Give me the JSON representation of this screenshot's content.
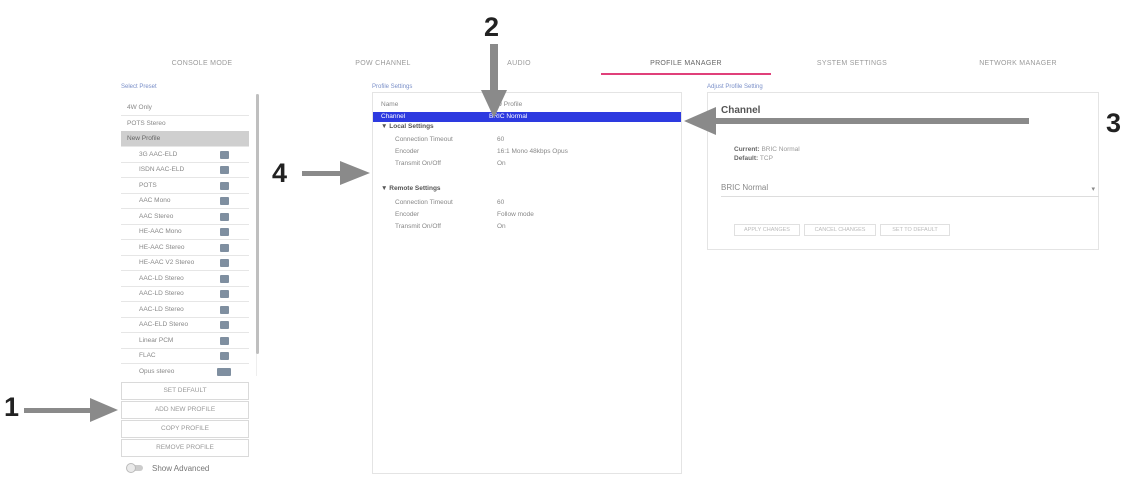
{
  "tabs": [
    {
      "label": "CONSOLE MODE"
    },
    {
      "label": "POW CHANNEL"
    },
    {
      "label": "AUDIO"
    },
    {
      "label": "PROFILE MANAGER"
    },
    {
      "label": "SYSTEM SETTINGS"
    },
    {
      "label": "NETWORK MANAGER"
    }
  ],
  "sections": {
    "presets": "Select Preset",
    "profile": "Profile Settings",
    "channel": "Adjust Profile Setting"
  },
  "presets": [
    {
      "label": "4W Only",
      "icon": ""
    },
    {
      "label": "POTS Stereo",
      "icon": ""
    },
    {
      "label": "New Profile",
      "icon": ""
    },
    {
      "label": "3G AAC-ELD",
      "icon": "preset-icon"
    },
    {
      "label": "ISDN AAC-ELD",
      "icon": "preset-icon"
    },
    {
      "label": "POTS",
      "icon": "preset-icon"
    },
    {
      "label": "AAC Mono",
      "icon": "preset-icon"
    },
    {
      "label": "AAC Stereo",
      "icon": "preset-icon"
    },
    {
      "label": "HE-AAC Mono",
      "icon": "preset-icon"
    },
    {
      "label": "HE-AAC Stereo",
      "icon": "preset-icon"
    },
    {
      "label": "HE-AAC V2 Stereo",
      "icon": "preset-icon"
    },
    {
      "label": "AAC-LD Stereo",
      "icon": "preset-icon"
    },
    {
      "label": "AAC-LD Stereo",
      "icon": "preset-icon"
    },
    {
      "label": "AAC-LD Stereo",
      "icon": "preset-icon"
    },
    {
      "label": "AAC-ELD Stereo",
      "icon": "preset-icon"
    },
    {
      "label": "Linear PCM",
      "icon": "preset-icon"
    },
    {
      "label": "FLAC",
      "icon": "preset-icon"
    },
    {
      "label": "Opus stereo",
      "icon": "preset-icon-wide"
    }
  ],
  "actions": {
    "set_default": "SET DEFAULT",
    "add_new": "ADD NEW PROFILE",
    "copy": "COPY PROFILE",
    "remove": "REMOVE PROFILE"
  },
  "show_advanced": "Show Advanced",
  "profile": {
    "name_key": "Name",
    "name_value": "New Profile",
    "channel_key": "Channel",
    "channel_value": "BRIC Normal",
    "local_title": "Local Settings",
    "local": [
      {
        "key": "Connection Timeout",
        "value": "60"
      },
      {
        "key": "Encoder",
        "value": "16:1 Mono 48kbps Opus"
      },
      {
        "key": "Transmit On/Off",
        "value": "On"
      }
    ],
    "remote_title": "Remote Settings",
    "remote": [
      {
        "key": "Connection Timeout",
        "value": "60"
      },
      {
        "key": "Encoder",
        "value": "Follow mode"
      },
      {
        "key": "Transmit On/Off",
        "value": "On"
      }
    ]
  },
  "channel": {
    "title": "Channel",
    "current_label": "Current:",
    "current_value": "BRIC Normal",
    "default_label": "Default:",
    "default_value": "TCP",
    "select_value": "BRIC Normal",
    "buttons": [
      "APPLY CHANGES",
      "CANCEL CHANGES",
      "SET TO DEFAULT"
    ]
  },
  "callouts": [
    "1",
    "2",
    "3",
    "4"
  ],
  "colors": {
    "tab_accent": "#e0407a",
    "highlight": "#2d3ae0",
    "arrow": "#8a8a8a"
  }
}
